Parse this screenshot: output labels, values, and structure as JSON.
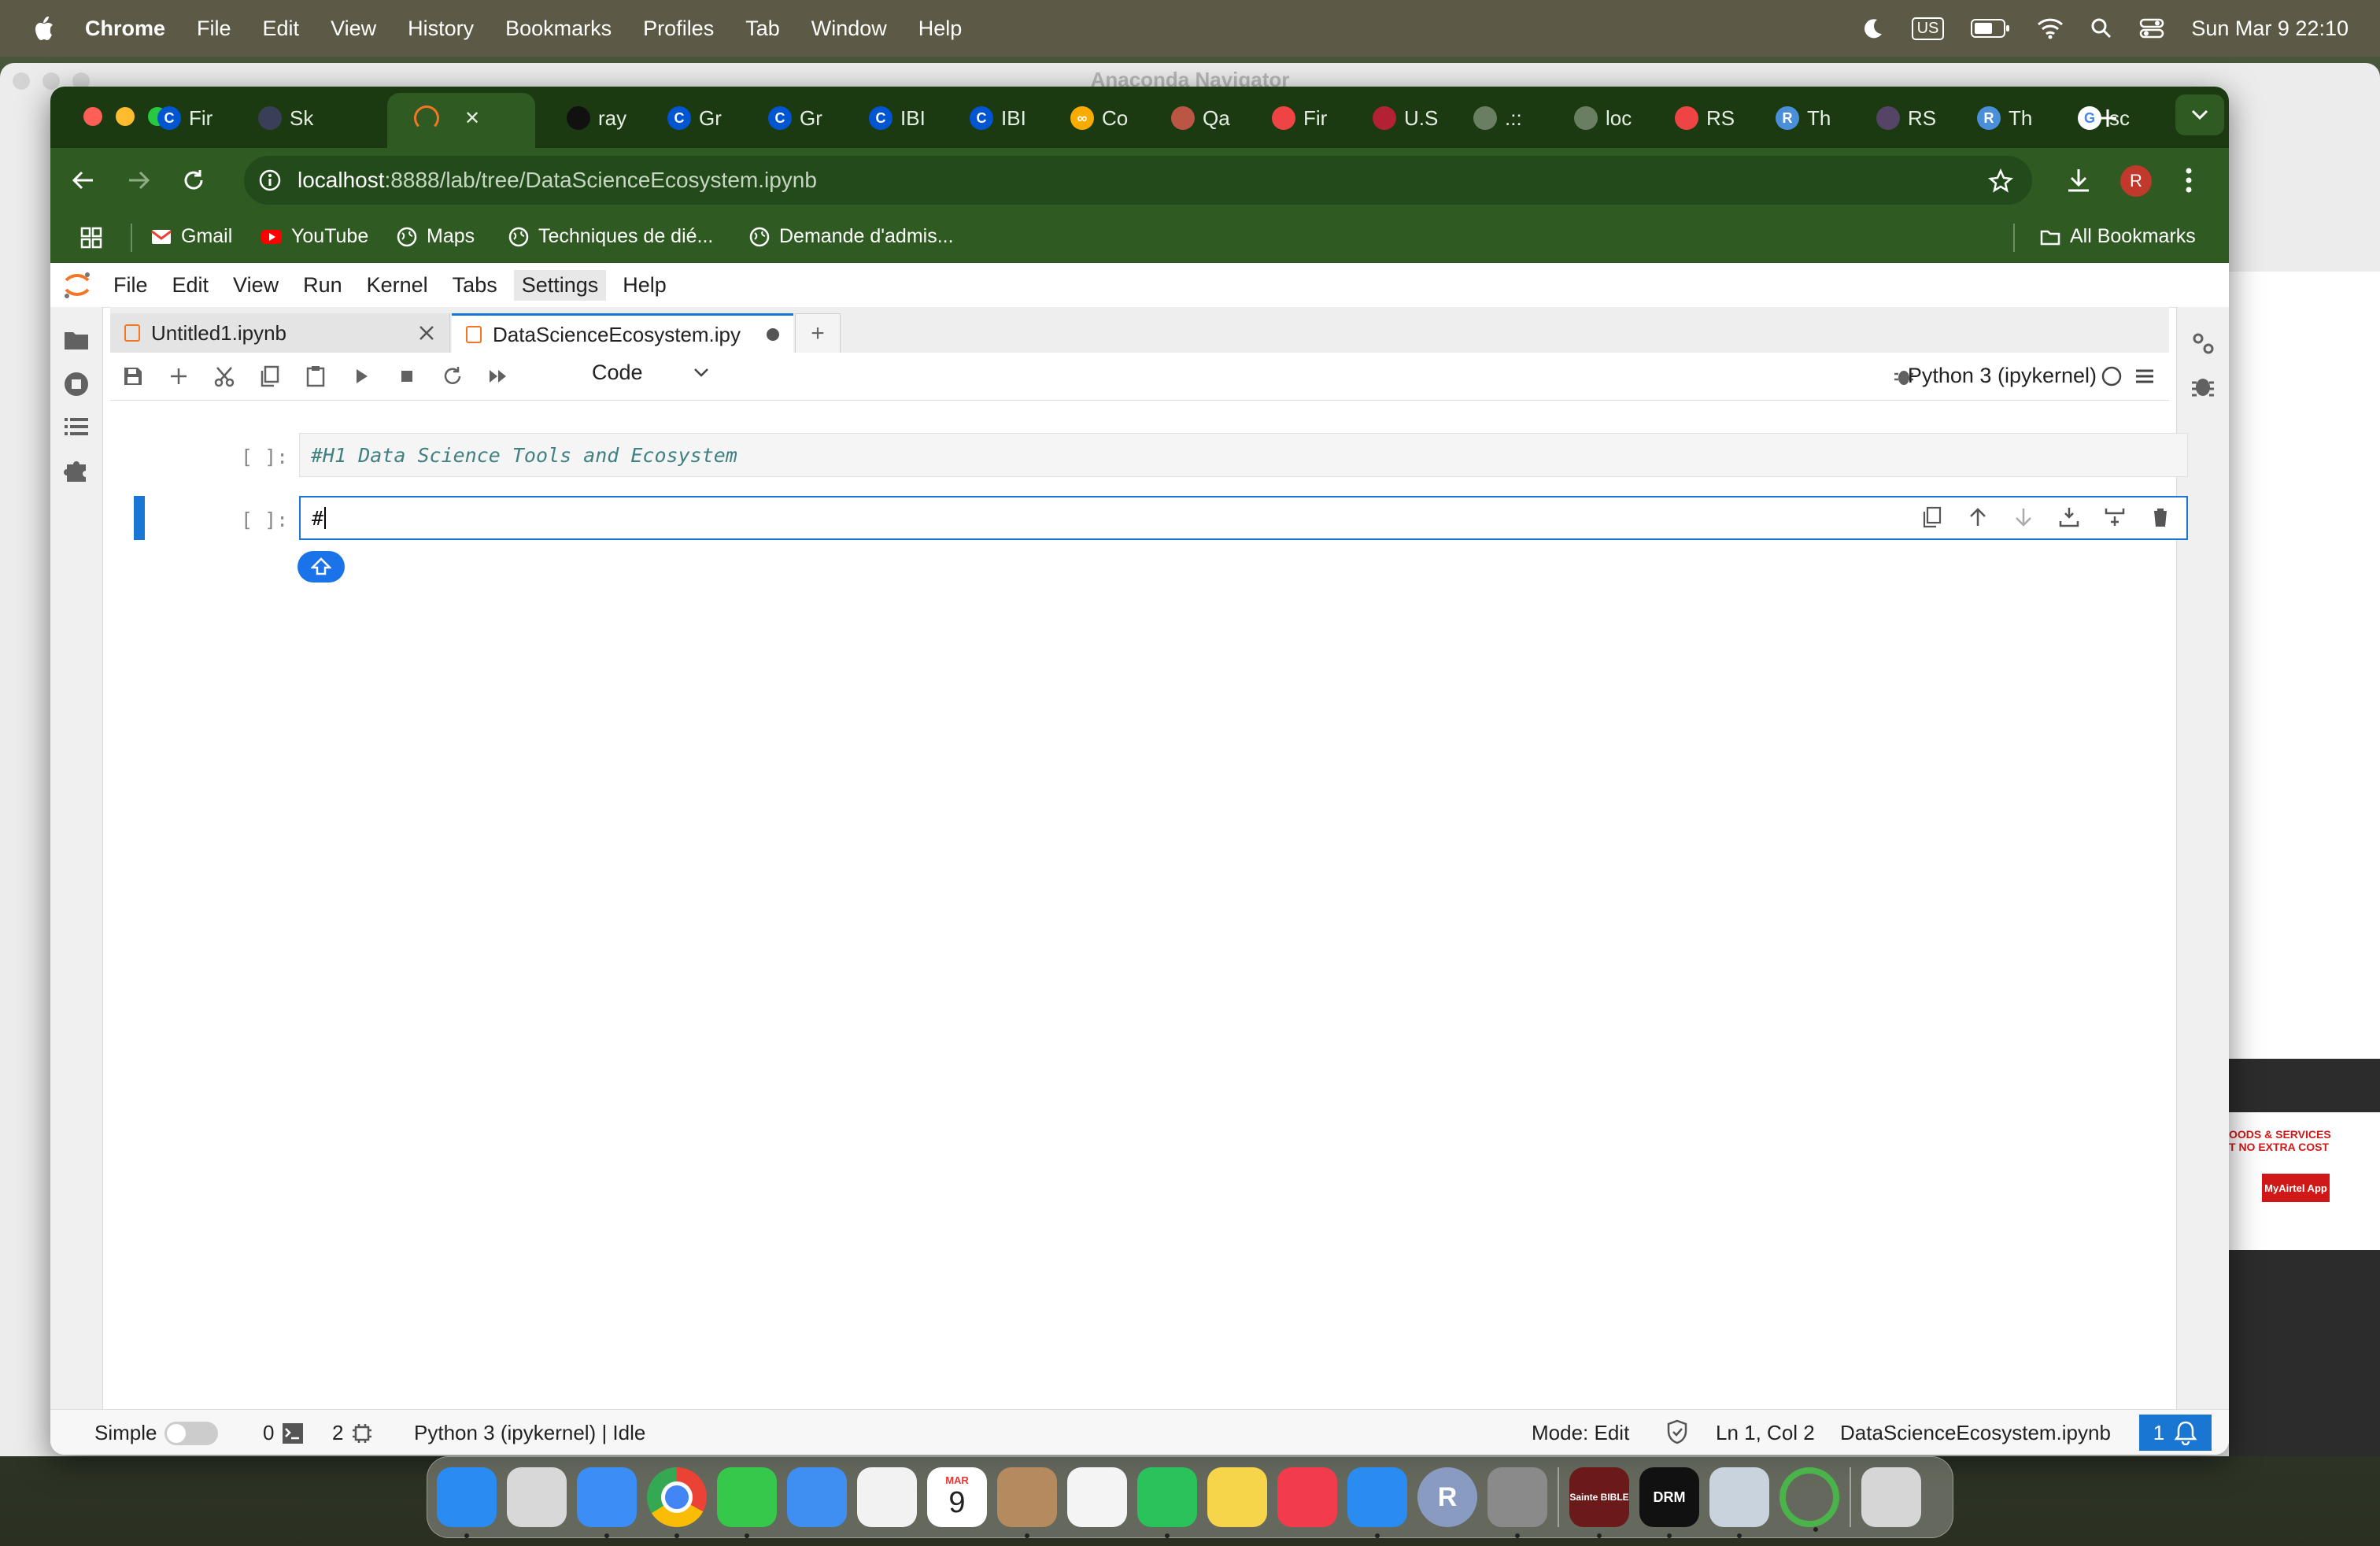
{
  "menubar": {
    "app_name": "Chrome",
    "items": [
      "File",
      "Edit",
      "View",
      "History",
      "Bookmarks",
      "Profiles",
      "Tab",
      "Window",
      "Help"
    ],
    "input_source": "US",
    "datetime": "Sun Mar 9  22:10"
  },
  "background_window": {
    "title": "Anaconda Navigator"
  },
  "chrome": {
    "tabs": [
      {
        "label": "Fir",
        "icon": "coursera-icon"
      },
      {
        "label": "Sk",
        "icon": "skills-icon"
      },
      {
        "label": "",
        "icon": "jupyter-loading-icon",
        "active": true
      },
      {
        "label": "ray",
        "icon": "github-icon"
      },
      {
        "label": "Gr",
        "icon": "coursera-icon"
      },
      {
        "label": "Gr",
        "icon": "coursera-icon"
      },
      {
        "label": "IBI",
        "icon": "coursera-icon"
      },
      {
        "label": "IBI",
        "icon": "coursera-icon"
      },
      {
        "label": "Co",
        "icon": "colab-icon"
      },
      {
        "label": "Qa",
        "icon": "music-icon"
      },
      {
        "label": "Fir",
        "icon": "document-icon"
      },
      {
        "label": "U.S",
        "icon": "flag-icon"
      },
      {
        "label": ".::",
        "icon": "globe-icon"
      },
      {
        "label": "loc",
        "icon": "globe-icon"
      },
      {
        "label": "RS",
        "icon": "document-icon"
      },
      {
        "label": "Th",
        "icon": "rstudio-icon"
      },
      {
        "label": "RS",
        "icon": "pattern-icon"
      },
      {
        "label": "Th",
        "icon": "rstudio-icon"
      },
      {
        "label": "sc",
        "icon": "google-icon"
      }
    ],
    "url_host": "localhost",
    "url_path": ":8888/lab/tree/DataScienceEcosystem.ipynb",
    "profile_initial": "R",
    "bookmarks": [
      {
        "label": "Gmail",
        "icon": "gmail-icon"
      },
      {
        "label": "YouTube",
        "icon": "youtube-icon"
      },
      {
        "label": "Maps",
        "icon": "globe-icon"
      },
      {
        "label": "Techniques de dié...",
        "icon": "globe-icon"
      },
      {
        "label": "Demande d'admis...",
        "icon": "globe-icon"
      }
    ],
    "all_bookmarks": "All Bookmarks",
    "ghost_bookmarks": "Bookmarks"
  },
  "jupyter": {
    "menu": [
      "File",
      "Edit",
      "View",
      "Run",
      "Kernel",
      "Tabs",
      "Settings",
      "Help"
    ],
    "tabs": [
      {
        "label": "Untitled1.ipynb",
        "active": false
      },
      {
        "label": "DataScienceEcosystem.ipy",
        "active": true
      }
    ],
    "cell_type": "Code",
    "kernel": "Python 3 (ipykernel)",
    "cells": [
      {
        "prompt": "[ ]:",
        "source": "#H1 Data Science Tools and Ecosystem"
      },
      {
        "prompt": "[ ]:",
        "source": "#"
      }
    ],
    "status": {
      "mode_label": "Simple",
      "terminals": "0",
      "kernels": "2",
      "kernel_status": "Python 3 (ipykernel) | Idle",
      "mode": "Mode: Edit",
      "cursor": "Ln 1, Col 2",
      "filename": "DataScienceEcosystem.ipynb",
      "notifications": "1"
    }
  },
  "background_ad": {
    "line1": "OODS & SERVICES",
    "line2": "T NO EXTRA COST",
    "badge": "MyAirtel App"
  },
  "dock": {
    "apps": [
      {
        "name": "finder-icon",
        "color": "#2a8cf0"
      },
      {
        "name": "launchpad-icon",
        "color": "#d8d8d8"
      },
      {
        "name": "safari-icon",
        "color": "#3b8ef5"
      },
      {
        "name": "chrome-icon",
        "color": "#e8e8e8"
      },
      {
        "name": "messages-icon",
        "color": "#35c84a"
      },
      {
        "name": "mail-icon",
        "color": "#3f8ff2"
      },
      {
        "name": "photos-icon",
        "color": "#f2f2f2"
      },
      {
        "name": "calendar-icon",
        "color": "#ffffff"
      },
      {
        "name": "contacts-icon",
        "color": "#b48a5e"
      },
      {
        "name": "reminders-icon",
        "color": "#f4f4f4"
      },
      {
        "name": "whatsapp-icon",
        "color": "#2ac25a"
      },
      {
        "name": "notes-icon",
        "color": "#f6d54a"
      },
      {
        "name": "music-icon",
        "color": "#f23c4c"
      },
      {
        "name": "appstore-icon",
        "color": "#2a8cf0"
      },
      {
        "name": "r-icon",
        "color": "#8a9bc2"
      },
      {
        "name": "system-settings-icon",
        "color": "#8a8a8a"
      },
      {
        "name": "bible-icon",
        "color": "#6b1a1a"
      },
      {
        "name": "drm-sports-icon",
        "color": "#111111"
      },
      {
        "name": "preview-icon",
        "color": "#c9d3dd"
      },
      {
        "name": "anaconda-icon",
        "color": "#2d2d2d"
      },
      {
        "name": "trash-icon",
        "color": "#d6d6d6"
      }
    ],
    "calendar_month": "MAR",
    "calendar_day": "9",
    "bible_label": "Sainte BIBLE",
    "drm_label": "DRM"
  }
}
